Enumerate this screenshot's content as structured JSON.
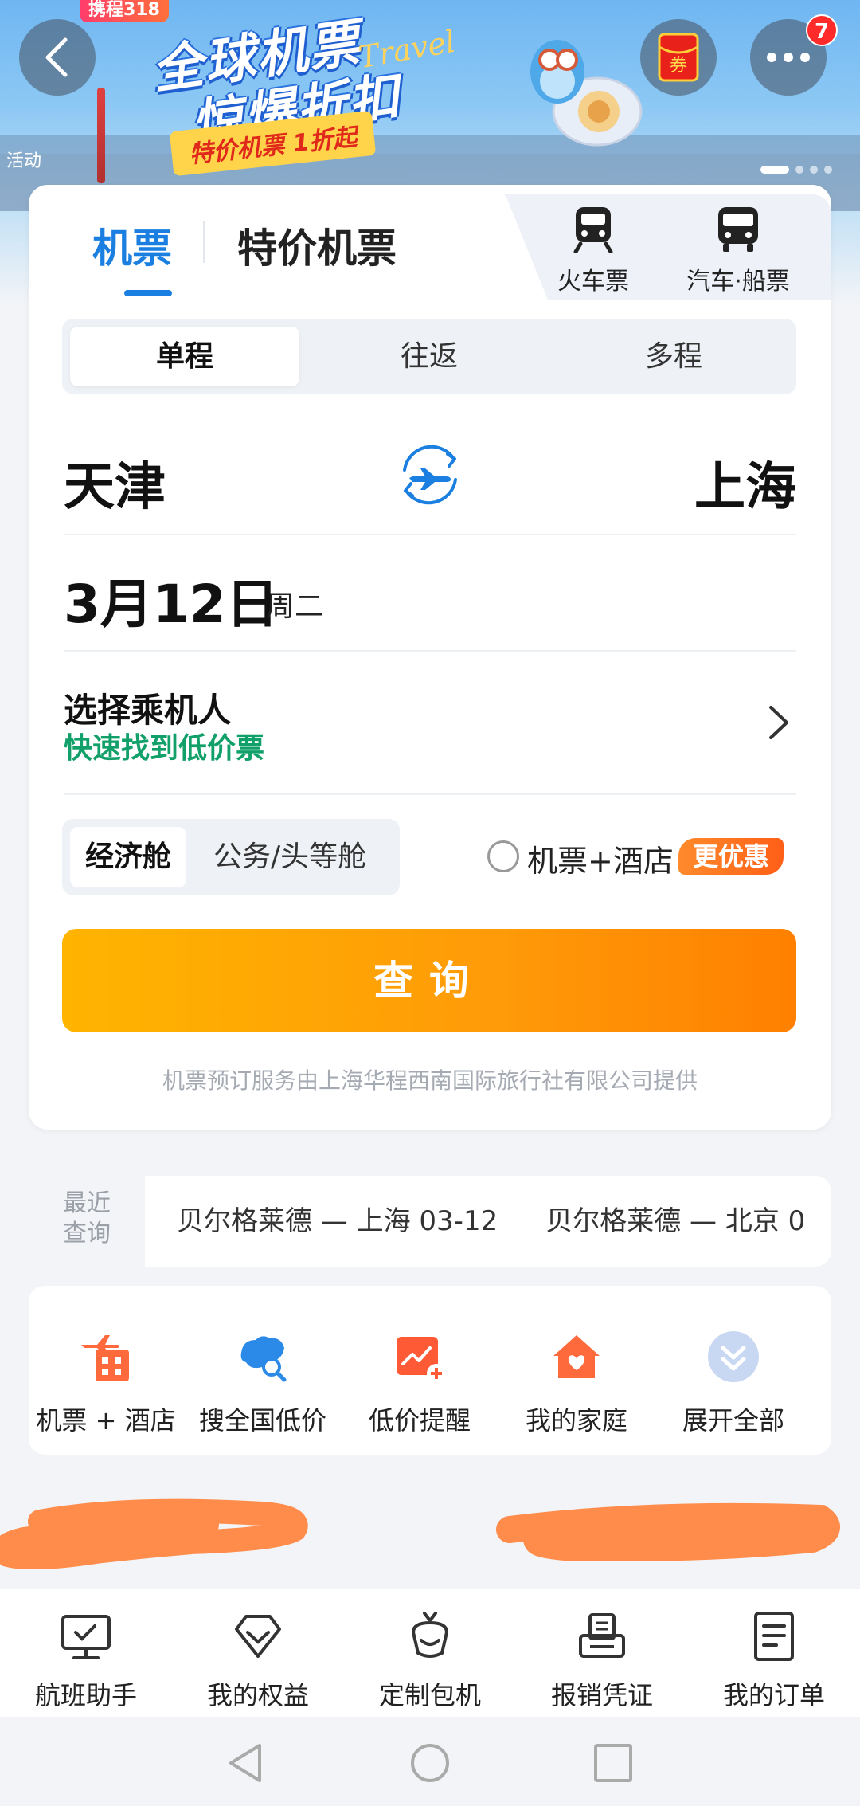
{
  "banner": {
    "tag": "携程318",
    "title_line1": "全球机票",
    "title_line2": "惊爆折扣",
    "travel_script": "Travel",
    "subtitle": "特价机票 1折起",
    "activity_label": "活动",
    "coupon_label": "券",
    "notification_count": "7"
  },
  "tabs": {
    "flight": "机票",
    "special": "特价机票",
    "train": "火车票",
    "bus_ferry": "汽车·船票"
  },
  "trip_type": {
    "one_way": "单程",
    "round_trip": "往返",
    "multi_city": "多程",
    "selected": "单程"
  },
  "route": {
    "from": "天津",
    "to": "上海"
  },
  "date": {
    "value": "3月12日",
    "weekday": "周二"
  },
  "passenger": {
    "title": "选择乘机人",
    "subtitle": "快速找到低价票"
  },
  "cabin": {
    "economy": "经济舱",
    "business_first": "公务/头等舱",
    "selected": "经济舱"
  },
  "combo": {
    "label": "机票+酒店",
    "tag": "更优惠",
    "checked": false
  },
  "search_button": "查询",
  "provider_note": "机票预订服务由上海华程西南国际旅行社有限公司提供",
  "recent": {
    "label_line1": "最近",
    "label_line2": "查询",
    "items": [
      {
        "text": "贝尔格莱德 — 上海 03-12"
      },
      {
        "text": "贝尔格莱德 — 北京 0"
      }
    ]
  },
  "quick_actions": [
    {
      "label": "机票 + 酒店",
      "icon": "flight-hotel-icon"
    },
    {
      "label": "搜全国低价",
      "icon": "china-map-search-icon"
    },
    {
      "label": "低价提醒",
      "icon": "price-alert-icon"
    },
    {
      "label": "我的家庭",
      "icon": "family-home-icon"
    },
    {
      "label": "展开全部",
      "icon": "expand-all-icon"
    }
  ],
  "bottom_nav": [
    {
      "label": "航班助手",
      "icon": "flight-assistant-icon"
    },
    {
      "label": "我的权益",
      "icon": "benefits-diamond-icon"
    },
    {
      "label": "定制包机",
      "icon": "charter-icon"
    },
    {
      "label": "报销凭证",
      "icon": "receipt-printer-icon"
    },
    {
      "label": "我的订单",
      "icon": "orders-document-icon"
    }
  ],
  "colors": {
    "brand_blue": "#1a7fe0",
    "orange": "#ff9a08",
    "green": "#12a06a",
    "redaction": "#ff8c4a"
  }
}
